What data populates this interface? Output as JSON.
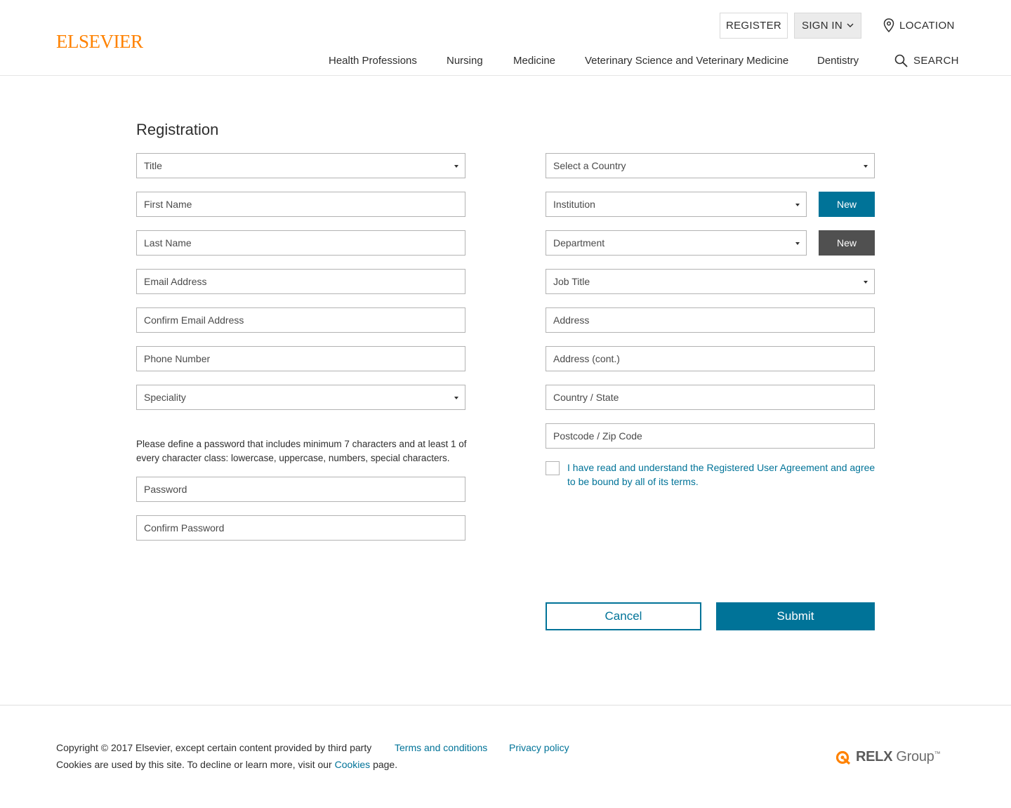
{
  "header": {
    "logo": "ELSEVIER",
    "register_label": "REGISTER",
    "signin_label": "SIGN IN",
    "location_label": "LOCATION",
    "search_label": "SEARCH",
    "nav": [
      {
        "label": "Health Professions"
      },
      {
        "label": "Nursing"
      },
      {
        "label": "Medicine"
      },
      {
        "label": "Veterinary Science and Veterinary Medicine"
      },
      {
        "label": "Dentistry"
      }
    ]
  },
  "form": {
    "title": "Registration",
    "left_fields": {
      "title": "Title",
      "first_name": "First Name",
      "last_name": "Last Name",
      "email": "Email Address",
      "confirm_email": "Confirm Email Address",
      "phone": "Phone Number",
      "speciality": "Speciality"
    },
    "password_help": "Please define a password that includes minimum 7 characters and at least 1 of every character class: lowercase, uppercase, numbers, special characters.",
    "password": "Password",
    "confirm_password": "Confirm Password",
    "right_fields": {
      "country": "Select a Country",
      "institution": "Institution",
      "department": "Department",
      "job_title": "Job Title",
      "address": "Address",
      "address_cont": "Address (cont.)",
      "country_state": "Country / State",
      "postcode": "Postcode / Zip Code"
    },
    "new_label": "New",
    "agree_text": "I have read and understand the Registered User Agreement and agree to be bound by all of its terms.",
    "cancel_label": "Cancel",
    "submit_label": "Submit"
  },
  "footer": {
    "copyright": "Copyright © 2017 Elsevier, except certain content provided by third party",
    "cookies_prefix": "Cookies are used by this site. To decline or learn more, visit our ",
    "cookies_link": "Cookies",
    "cookies_suffix": " page.",
    "terms": "Terms and conditions",
    "privacy": "Privacy policy",
    "relx_bold": "RELX",
    "relx_rest": " Group",
    "relx_tm": "™"
  },
  "colors": {
    "brand_orange": "#ff8200",
    "accent_blue": "#007398",
    "dark_grey_button": "#505050"
  }
}
